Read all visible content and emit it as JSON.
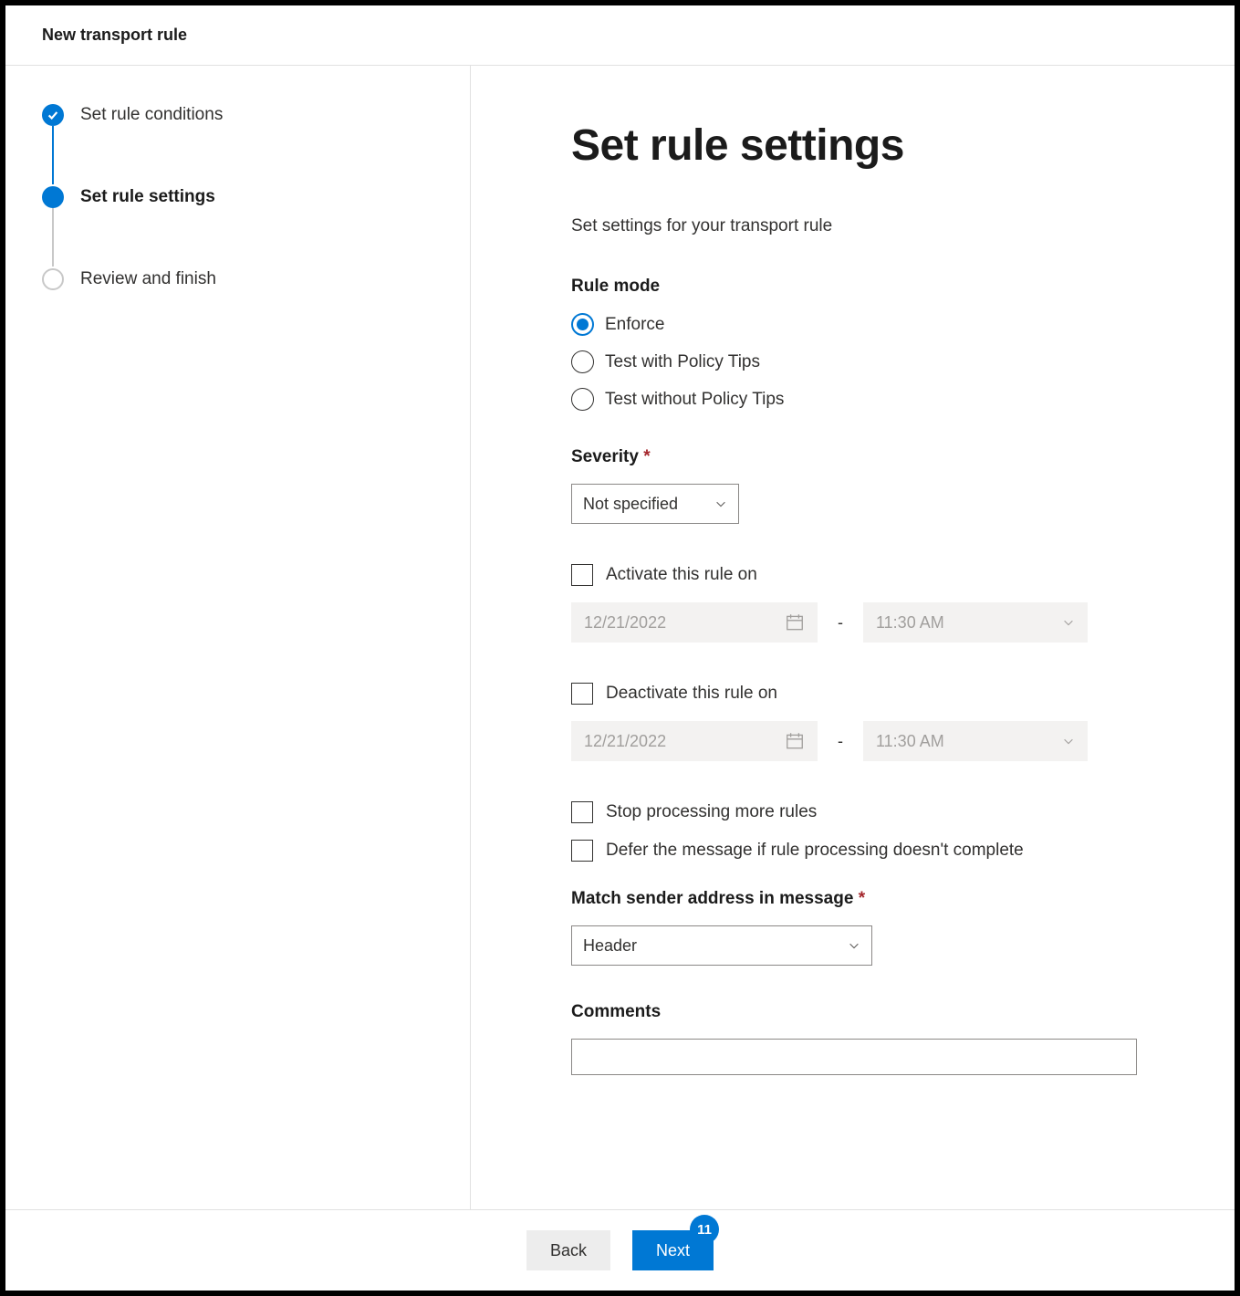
{
  "header": {
    "title": "New transport rule"
  },
  "steps": [
    {
      "label": "Set rule conditions",
      "state": "completed"
    },
    {
      "label": "Set rule settings",
      "state": "current"
    },
    {
      "label": "Review and finish",
      "state": "pending"
    }
  ],
  "main": {
    "title": "Set rule settings",
    "description": "Set settings for your transport rule",
    "ruleMode": {
      "label": "Rule mode",
      "options": [
        {
          "label": "Enforce",
          "checked": true
        },
        {
          "label": "Test with Policy Tips",
          "checked": false
        },
        {
          "label": "Test without Policy Tips",
          "checked": false
        }
      ]
    },
    "severity": {
      "label": "Severity",
      "required": true,
      "value": "Not specified"
    },
    "activate": {
      "label": "Activate this rule on",
      "date": "12/21/2022",
      "time": "11:30 AM"
    },
    "deactivate": {
      "label": "Deactivate this rule on",
      "date": "12/21/2022",
      "time": "11:30 AM"
    },
    "stopProcessing": {
      "label": "Stop processing more rules"
    },
    "deferMessage": {
      "label": "Defer the message if rule processing doesn't complete"
    },
    "matchSender": {
      "label": "Match sender address in message",
      "required": true,
      "value": "Header"
    },
    "comments": {
      "label": "Comments"
    }
  },
  "footer": {
    "back": "Back",
    "next": "Next",
    "badge": "11"
  }
}
